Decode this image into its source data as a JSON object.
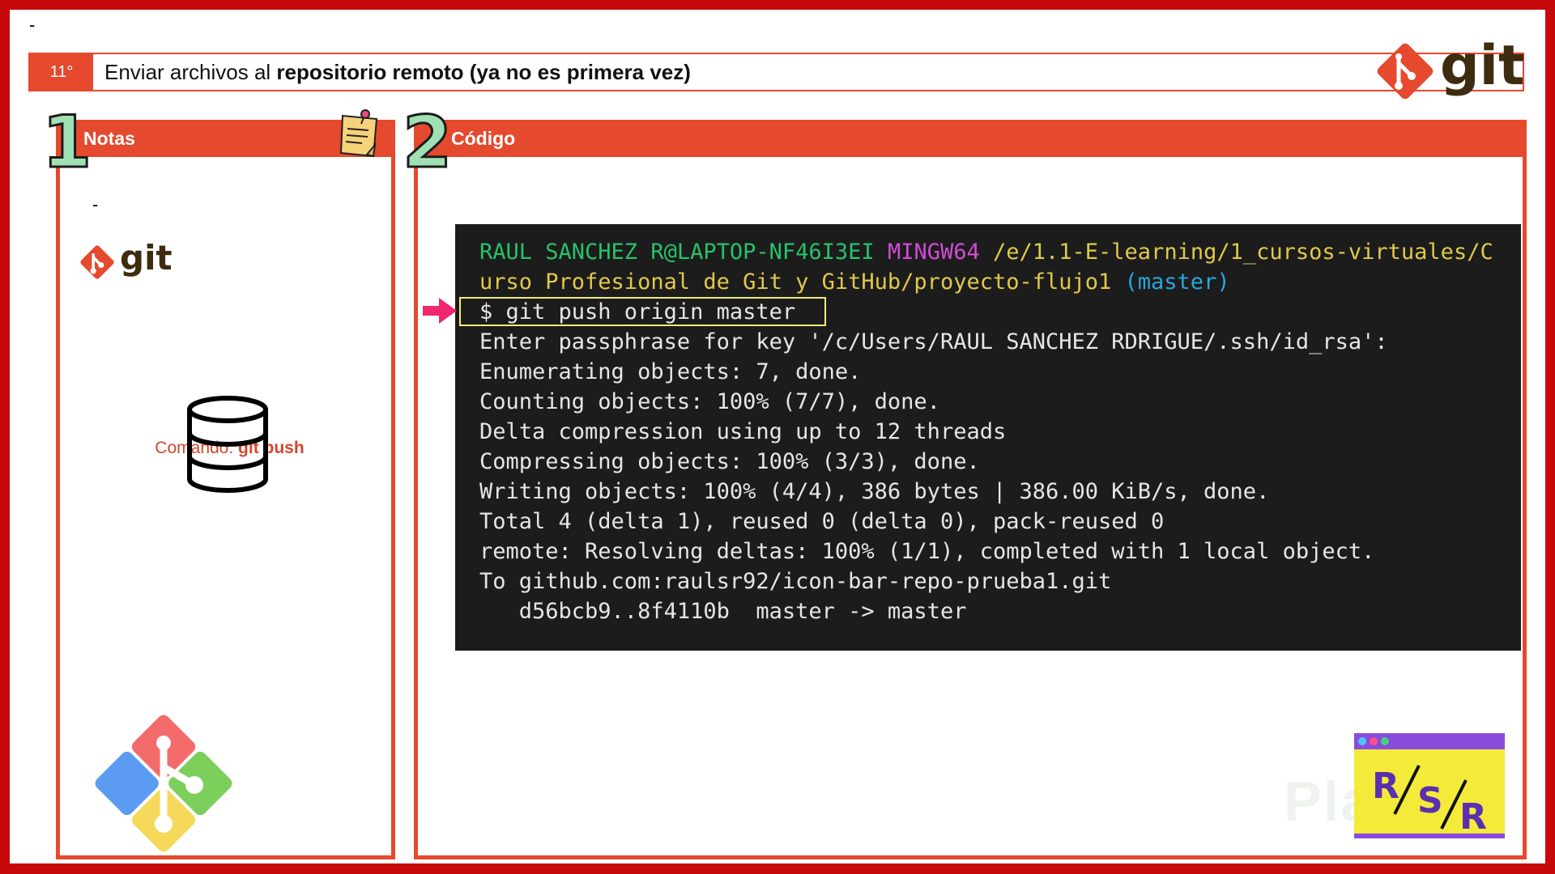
{
  "slide": {
    "top_dash": "-",
    "lesson_number": "11°",
    "title_normal": "Enviar archivos al ",
    "title_bold": "repositorio remoto (ya no es primera vez)",
    "brand_word": "git"
  },
  "notes_panel": {
    "step_number": "1",
    "heading": "Notas",
    "dash": "-",
    "brand_word": "git",
    "command_label": "Comando: ",
    "command_value": "git push"
  },
  "code_panel": {
    "step_number": "2",
    "heading": "Código"
  },
  "terminal": {
    "prompt_user": "RAUL SANCHEZ R@LAPTOP-NF46I3EI",
    "prompt_env": "MINGW64",
    "prompt_path_line1": "/e/1.1-E-learning/1_cursos-virtuales/C",
    "prompt_path_line2": "urso Profesional de Git y GitHub/proyecto-flujo1",
    "prompt_branch": "(master)",
    "command": "$ git push origin master",
    "output": [
      "Enter passphrase for key '/c/Users/RAUL SANCHEZ RDRIGUE/.ssh/id_rsa':",
      "Enumerating objects: 7, done.",
      "Counting objects: 100% (7/7), done.",
      "Delta compression using up to 12 threads",
      "Compressing objects: 100% (3/3), done.",
      "Writing objects: 100% (4/4), 386 bytes | 386.00 KiB/s, done.",
      "Total 4 (delta 1), reused 0 (delta 0), pack-reused 0",
      "remote: Resolving deltas: 100% (1/1), completed with 1 local object.",
      "To github.com:raulsr92/icon-bar-repo-prueba1.git",
      "   d56bcb9..8f4110b  master -> master"
    ]
  },
  "watermark": "Platzi",
  "colors": {
    "frame": "#c8090b",
    "accent": "#e5492e",
    "terminal_bg": "#1c1c1c"
  },
  "icons": [
    "git-logo-icon",
    "sticky-note-icon",
    "database-icon",
    "git-diamond-icon",
    "pink-arrow-icon",
    "rsr-logo-icon"
  ]
}
